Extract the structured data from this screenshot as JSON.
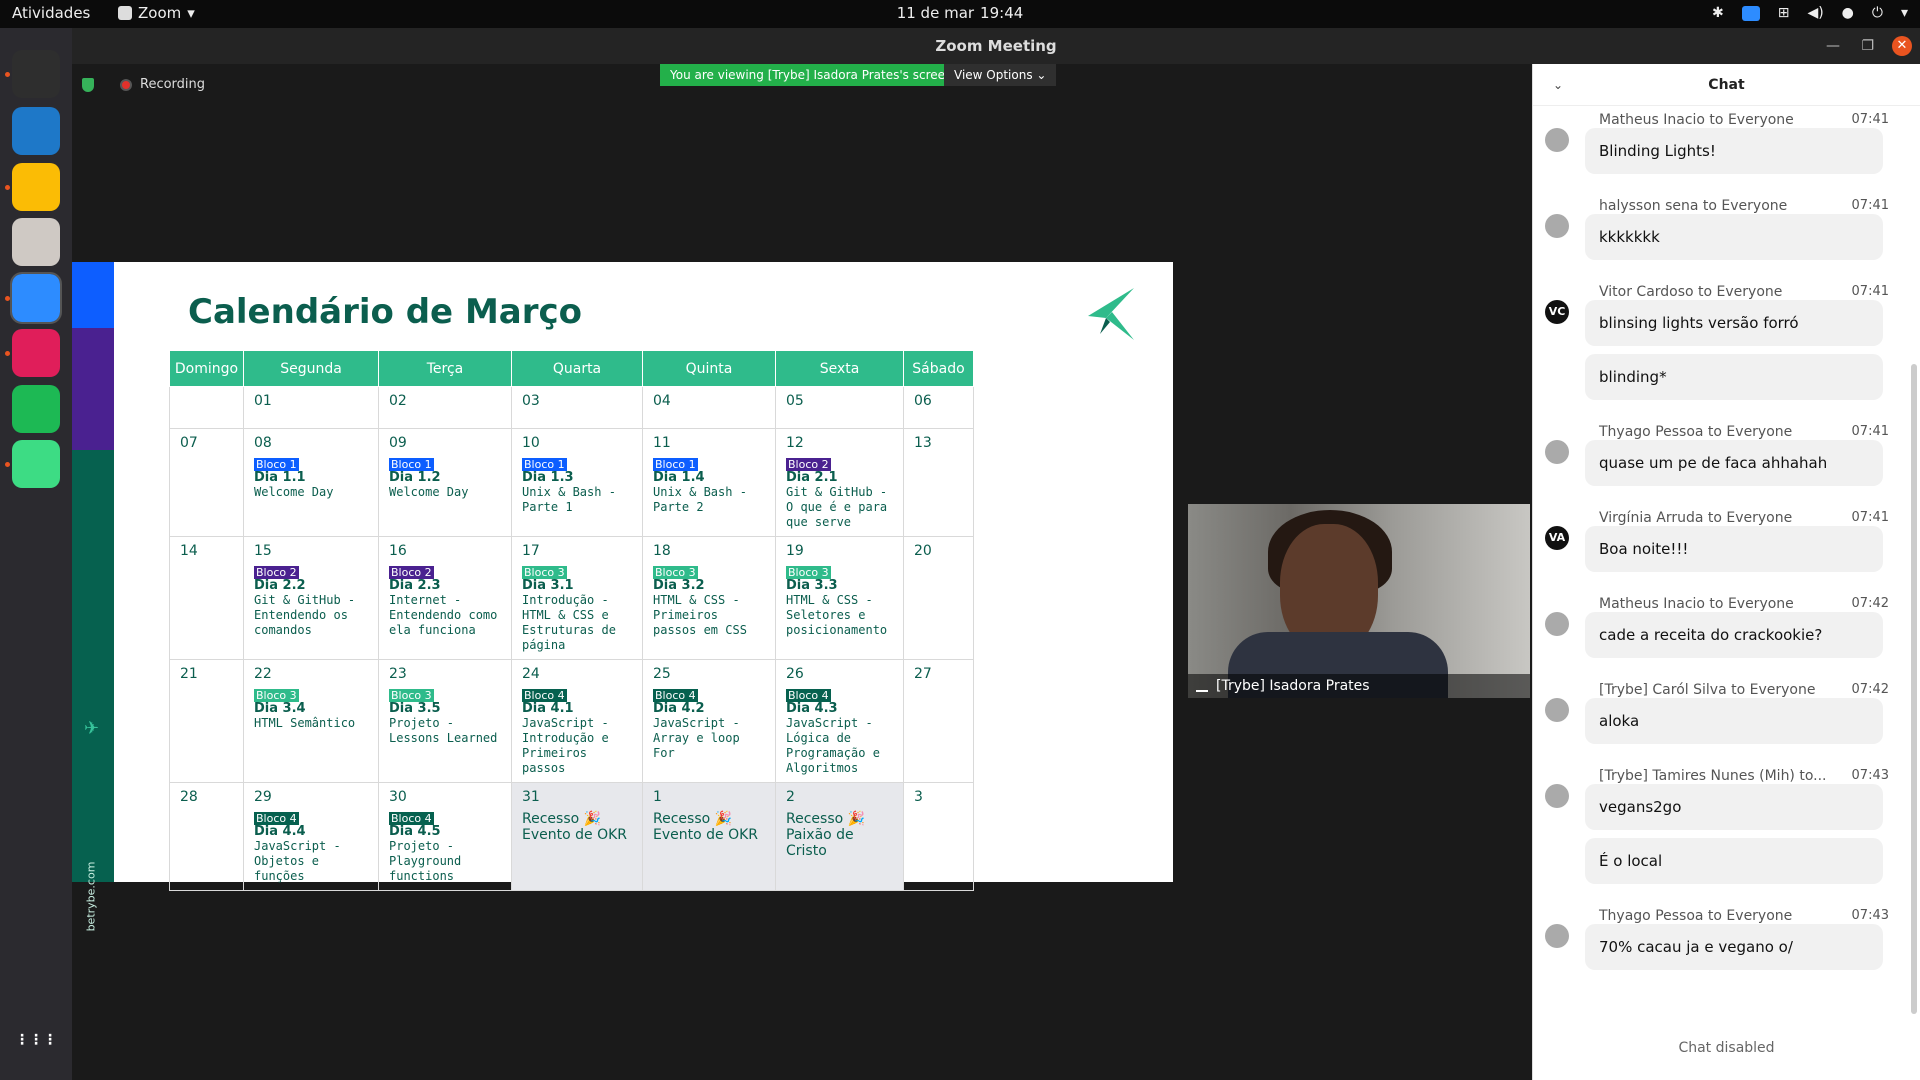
{
  "topbar": {
    "activities": "Atividades",
    "app": "Zoom",
    "date": "11 de mar",
    "time": "19:44"
  },
  "dock": {
    "items": [
      {
        "name": "terminal",
        "color": "#2e2e2e"
      },
      {
        "name": "vscode",
        "color": "#1e78c8"
      },
      {
        "name": "chrome",
        "color": "#fbbc05"
      },
      {
        "name": "files",
        "color": "#cfc9c4"
      },
      {
        "name": "zoom",
        "color": "#2d8cff"
      },
      {
        "name": "slack",
        "color": "#e01e5a"
      },
      {
        "name": "spotify",
        "color": "#1db954"
      },
      {
        "name": "android",
        "color": "#3ddc84"
      }
    ]
  },
  "window": {
    "title": "Zoom Meeting"
  },
  "meeting": {
    "recording": "Recording",
    "viewing": "You are viewing [Trybe] Isadora Prates's screen",
    "view_options": "View Options"
  },
  "slide": {
    "title": "Calendário de Março",
    "url": "betrybe.com",
    "headers": [
      "Domingo",
      "Segunda",
      "Terça",
      "Quarta",
      "Quinta",
      "Sexta",
      "Sábado"
    ],
    "weeks": [
      [
        {
          "n": "",
          "e": false
        },
        {
          "n": "01"
        },
        {
          "n": "02"
        },
        {
          "n": "03"
        },
        {
          "n": "04"
        },
        {
          "n": "05"
        },
        {
          "n": "06"
        }
      ],
      [
        {
          "n": "07"
        },
        {
          "n": "08",
          "tag": "Bloco 1",
          "cls": "b1",
          "dia": "Dia 1.1",
          "desc": "Welcome Day"
        },
        {
          "n": "09",
          "tag": "Bloco 1",
          "cls": "b1",
          "dia": "Dia 1.2",
          "desc": "Welcome Day"
        },
        {
          "n": "10",
          "tag": "Bloco 1",
          "cls": "b1",
          "dia": "Dia 1.3",
          "desc": "Unix & Bash - Parte 1"
        },
        {
          "n": "11",
          "tag": "Bloco 1",
          "cls": "b1",
          "dia": "Dia 1.4",
          "desc": "Unix & Bash - Parte 2"
        },
        {
          "n": "12",
          "tag": "Bloco 2",
          "cls": "b2",
          "dia": "Dia 2.1",
          "desc": "Git & GitHub - O que é e para que serve"
        },
        {
          "n": "13"
        }
      ],
      [
        {
          "n": "14"
        },
        {
          "n": "15",
          "tag": "Bloco 2",
          "cls": "b2",
          "dia": "Dia 2.2",
          "desc": "Git & GitHub - Entendendo os comandos"
        },
        {
          "n": "16",
          "tag": "Bloco 2",
          "cls": "b2",
          "dia": "Dia 2.3",
          "desc": "Internet - Entendendo como ela funciona"
        },
        {
          "n": "17",
          "tag": "Bloco 3",
          "cls": "b3",
          "dia": "Dia 3.1",
          "desc": "Introdução - HTML & CSS e Estruturas de página"
        },
        {
          "n": "18",
          "tag": "Bloco 3",
          "cls": "b3",
          "dia": "Dia 3.2",
          "desc": "HTML & CSS - Primeiros passos em CSS"
        },
        {
          "n": "19",
          "tag": "Bloco 3",
          "cls": "b3",
          "dia": "Dia 3.3",
          "desc": "HTML & CSS - Seletores e posicionamento"
        },
        {
          "n": "20"
        }
      ],
      [
        {
          "n": "21"
        },
        {
          "n": "22",
          "tag": "Bloco 3",
          "cls": "b3",
          "dia": "Dia 3.4",
          "desc": "HTML Semântico"
        },
        {
          "n": "23",
          "tag": "Bloco 3",
          "cls": "b3",
          "dia": "Dia 3.5",
          "desc": "Projeto - Lessons Learned"
        },
        {
          "n": "24",
          "tag": "Bloco 4",
          "cls": "b4",
          "dia": "Dia 4.1",
          "desc": "JavaScript - Introdução e Primeiros passos"
        },
        {
          "n": "25",
          "tag": "Bloco 4",
          "cls": "b4",
          "dia": "Dia 4.2",
          "desc": "JavaScript - Array e loop For"
        },
        {
          "n": "26",
          "tag": "Bloco 4",
          "cls": "b4",
          "dia": "Dia 4.3",
          "desc": "JavaScript - Lógica de Programação e Algoritmos"
        },
        {
          "n": "27"
        }
      ],
      [
        {
          "n": "28"
        },
        {
          "n": "29",
          "tag": "Bloco 4",
          "cls": "b4",
          "dia": "Dia 4.4",
          "desc": "JavaScript - Objetos e funções"
        },
        {
          "n": "30",
          "tag": "Bloco 4",
          "cls": "b4",
          "dia": "Dia 4.5",
          "desc": "Projeto - Playground functions"
        },
        {
          "n": "31",
          "gray": true,
          "r1": "Recesso 🎉",
          "r2": "Evento de OKR"
        },
        {
          "n": "1",
          "gray": true,
          "r1": "Recesso 🎉",
          "r2": "Evento de OKR"
        },
        {
          "n": "2",
          "gray": true,
          "r1": "Recesso 🎉",
          "r2": "Paixão de Cristo"
        },
        {
          "n": "3"
        }
      ]
    ]
  },
  "video": {
    "name": "[Trybe] Isadora Prates"
  },
  "chat": {
    "title": "Chat",
    "disabled": "Chat disabled",
    "messages": [
      {
        "from": "Matheus Inacio to Everyone",
        "time": "07:41",
        "texts": [
          "Blinding Lights!"
        ],
        "av": "",
        "dark": false
      },
      {
        "from": "halysson sena to Everyone",
        "time": "07:41",
        "texts": [
          "kkkkkkk"
        ],
        "av": "",
        "dark": false
      },
      {
        "from": "Vitor Cardoso to Everyone",
        "time": "07:41",
        "texts": [
          "blinsing lights versão forró",
          "blinding*"
        ],
        "av": "VC",
        "dark": true
      },
      {
        "from": "Thyago Pessoa to Everyone",
        "time": "07:41",
        "texts": [
          "quase um pe de faca ahhahah"
        ],
        "av": "",
        "dark": false
      },
      {
        "from": "Virgínia Arruda to Everyone",
        "time": "07:41",
        "texts": [
          "Boa noite!!!"
        ],
        "av": "VA",
        "dark": true
      },
      {
        "from": "Matheus Inacio to Everyone",
        "time": "07:42",
        "texts": [
          "cade a receita do crackookie?"
        ],
        "av": "",
        "dark": false
      },
      {
        "from": "[Trybe] Caról Silva to Everyone",
        "time": "07:42",
        "texts": [
          "aloka"
        ],
        "av": "",
        "dark": false
      },
      {
        "from": "[Trybe] Tamires Nunes (Mih) to...",
        "time": "07:43",
        "texts": [
          "vegans2go",
          "É o local"
        ],
        "av": "",
        "dark": false
      },
      {
        "from": "Thyago Pessoa to Everyone",
        "time": "07:43",
        "texts": [
          "70% cacau ja e vegano o/"
        ],
        "av": "",
        "dark": false
      }
    ]
  }
}
